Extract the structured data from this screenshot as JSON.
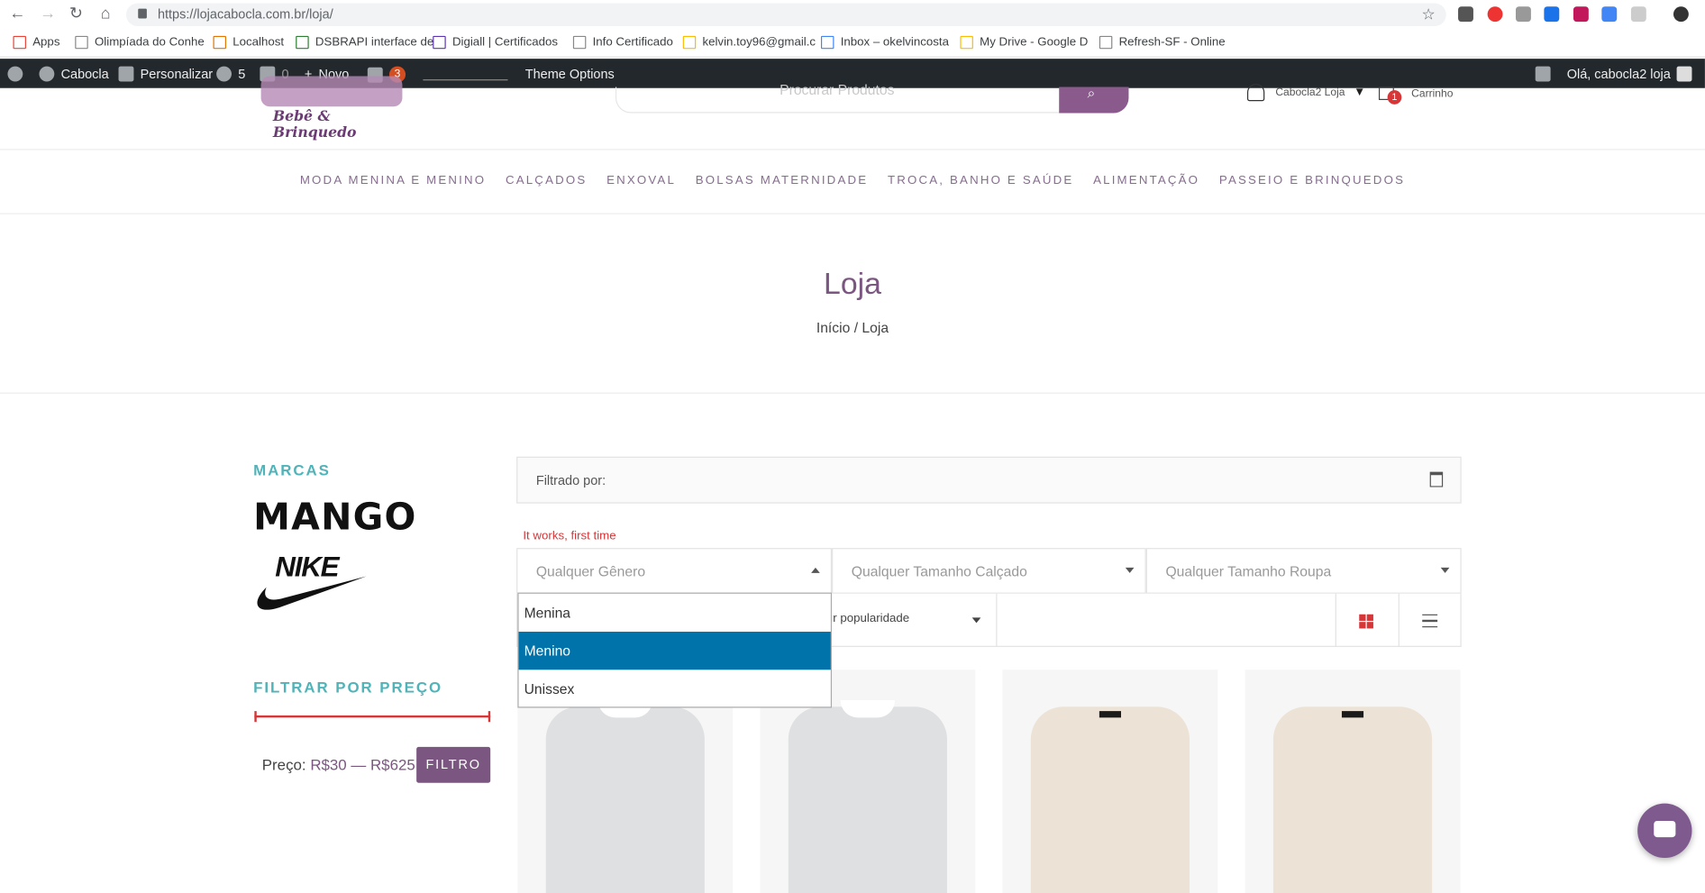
{
  "browser": {
    "url": "https://lojacabocla.com.br/loja/"
  },
  "bookmarks": [
    "Apps",
    "Olimpíada do Conhe",
    "Localhost",
    "DSBRAPI interface de",
    "Digiall | Certificados",
    "Info Certificado",
    "kelvin.toy96@gmail.c",
    "Inbox – okelvincosta",
    "My Drive - Google D",
    "Refresh-SF - Online"
  ],
  "wpbar": {
    "site": "Cabocla",
    "customize": "Personalizar",
    "updates": "5",
    "comments": "0",
    "new": "Novo",
    "yoast": "3",
    "theme_options": "Theme Options",
    "greeting": "Olá, cabocla2 loja"
  },
  "header": {
    "logo_sub": "Bebê & Brinquedo",
    "search_placeholder": "Procurar Produtos",
    "account": "Cabocla2 Loja",
    "cart_count": "1",
    "cart_label": "Carrinho"
  },
  "menu": [
    "MODA MENINA E MENINO",
    "CALÇADOS",
    "ENXOVAL",
    "BOLSAS MATERNIDADE",
    "TROCA, BANHO E SAÚDE",
    "ALIMENTAÇÃO",
    "PASSEIO E BRINQUEDOS"
  ],
  "page": {
    "title": "Loja",
    "breadcrumb": "Início / Loja"
  },
  "sidebar": {
    "brands_title": "MARCAS",
    "brand1": "MANGO",
    "brand2": "NIKE",
    "price_title": "FILTRAR POR PREÇO",
    "price_label": "Preço:",
    "price_range": "R$30 — R$625",
    "filter_button": "FILTRO"
  },
  "filters": {
    "filtered_by": "Filtrado por:",
    "notice": "It works, first time",
    "gender": "Qualquer Gênero",
    "shoe_size": "Qualquer Tamanho Calçado",
    "clothes_size": "Qualquer Tamanho Roupa",
    "sort": "r popularidade",
    "gender_options": [
      "Menina",
      "Menino",
      "Unissex"
    ],
    "selected": "Menino"
  },
  "colors": {
    "accent": "#7b5680",
    "teal": "#4fb3b8",
    "red": "#d63638",
    "selected": "#0073aa"
  }
}
